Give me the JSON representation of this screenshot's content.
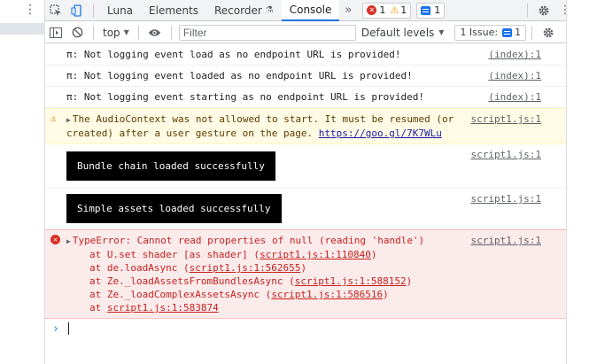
{
  "tabs": {
    "inspect_icon": "inspect-icon",
    "device_icon": "device-toggle-icon",
    "items": [
      "Luna",
      "Elements",
      "Recorder",
      "Console"
    ],
    "active": "Console",
    "more": "»",
    "error_count": "1",
    "warning_count": "1",
    "message_count": "1"
  },
  "toolbar": {
    "context": "top",
    "filter_placeholder": "Filter",
    "levels": "Default levels",
    "issues_label": "1 Issue:",
    "issues_count": "1"
  },
  "console": {
    "messages": [
      {
        "type": "log",
        "text": "π: Not logging event load as no endpoint URL is provided!",
        "source": "(index):1"
      },
      {
        "type": "log",
        "text": "π: Not logging event loaded as no endpoint URL is provided!",
        "source": "(index):1"
      },
      {
        "type": "log",
        "text": "π: Not logging event starting as no endpoint URL is provided!",
        "source": "(index):1"
      }
    ],
    "warning": {
      "text": "The AudioContext was not allowed to start. It must be resumed (or created) after a user gesture on the page.",
      "link": "https://goo.gl/7K7WLu",
      "source": "script1.js:1"
    },
    "styled": [
      {
        "text": "Bundle chain loaded successfully",
        "source": "script1.js:1"
      },
      {
        "text": "Simple assets loaded successfully",
        "source": "script1.js:1"
      }
    ],
    "error": {
      "text": "TypeError: Cannot read properties of null (reading 'handle')",
      "source": "script1.js:1",
      "stack": [
        {
          "prefix": "at U.set shader [as shader] (",
          "link": "script1.js:1:110840",
          "suffix": ")"
        },
        {
          "prefix": "at de.loadAsync (",
          "link": "script1.js:1:562655",
          "suffix": ")"
        },
        {
          "prefix": "at Ze._loadAssetsFromBundlesAsync (",
          "link": "script1.js:1:588152",
          "suffix": ")"
        },
        {
          "prefix": "at Ze._loadComplexAssetsAsync (",
          "link": "script1.js:1:586516",
          "suffix": ")"
        },
        {
          "prefix": "at ",
          "link": "script1.js:1:583874",
          "suffix": ""
        }
      ]
    },
    "prompt": "›"
  }
}
